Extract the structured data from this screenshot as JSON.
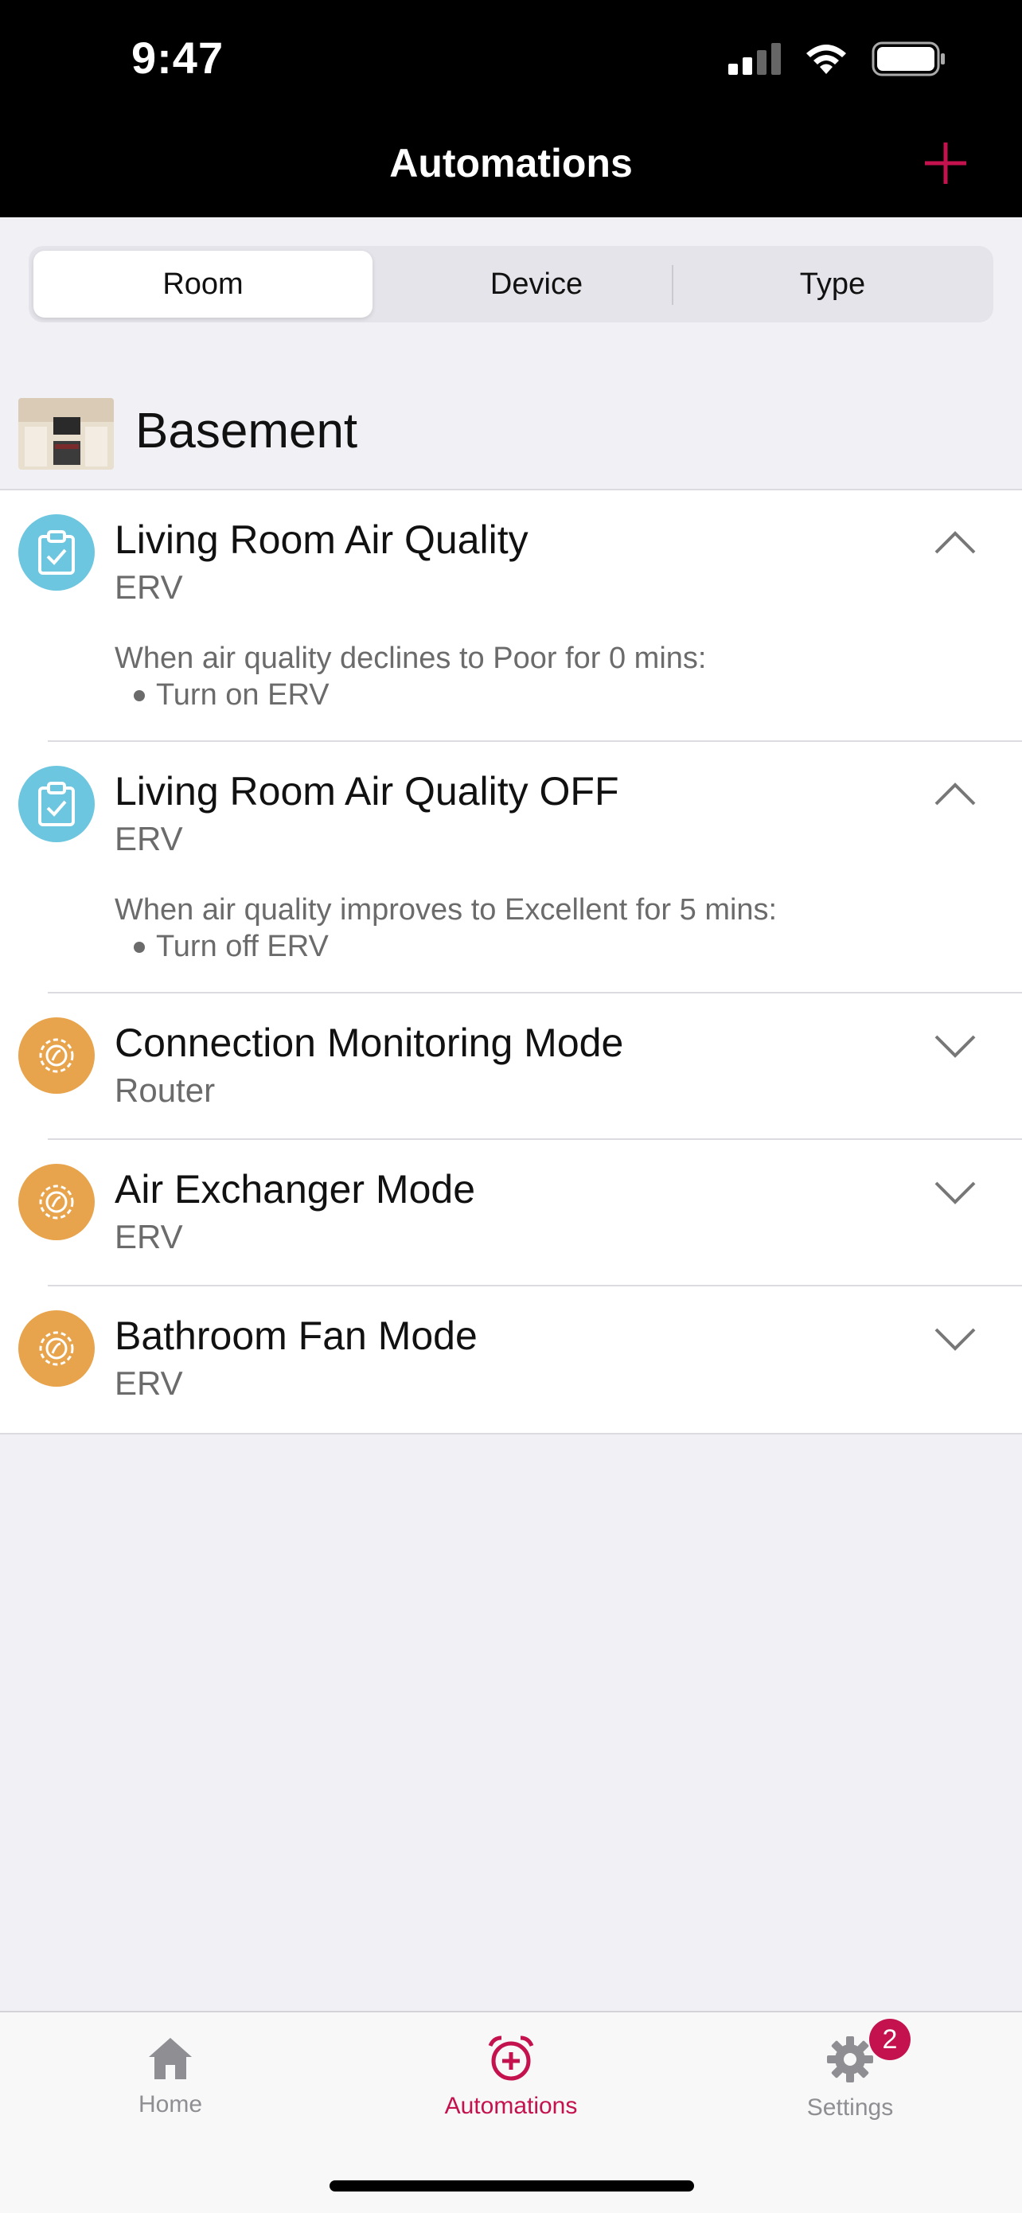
{
  "status_bar": {
    "time": "9:47"
  },
  "nav": {
    "title": "Automations",
    "add_icon": "plus-icon"
  },
  "segments": [
    {
      "label": "Room",
      "active": true
    },
    {
      "label": "Device",
      "active": false
    },
    {
      "label": "Type",
      "active": false
    }
  ],
  "room": {
    "name": "Basement"
  },
  "automations": [
    {
      "title": "Living Room Air Quality",
      "device": "ERV",
      "icon": "clipboard-check-icon",
      "expanded": true,
      "condition": "When air quality declines to Poor for 0 mins:",
      "action": "Turn on ERV"
    },
    {
      "title": "Living Room Air Quality OFF",
      "device": "ERV",
      "icon": "clipboard-check-icon",
      "expanded": true,
      "condition": "When air quality improves to Excellent for 5 mins:",
      "action": "Turn off ERV"
    },
    {
      "title": "Connection Monitoring Mode",
      "device": "Router",
      "icon": "gear-icon",
      "expanded": false
    },
    {
      "title": "Air Exchanger Mode",
      "device": "ERV",
      "icon": "gear-icon",
      "expanded": false
    },
    {
      "title": "Bathroom Fan Mode",
      "device": "ERV",
      "icon": "gear-icon",
      "expanded": false
    }
  ],
  "tabs": [
    {
      "label": "Home",
      "icon": "home-icon",
      "active": false
    },
    {
      "label": "Automations",
      "icon": "alarm-plus-icon",
      "active": true
    },
    {
      "label": "Settings",
      "icon": "gear-icon",
      "active": false,
      "badge": "2"
    }
  ],
  "colors": {
    "accent": "#c4124e",
    "blue_icon": "#6cc6df",
    "orange_icon": "#e8a44c",
    "inactive_tab": "#8e8e93"
  }
}
